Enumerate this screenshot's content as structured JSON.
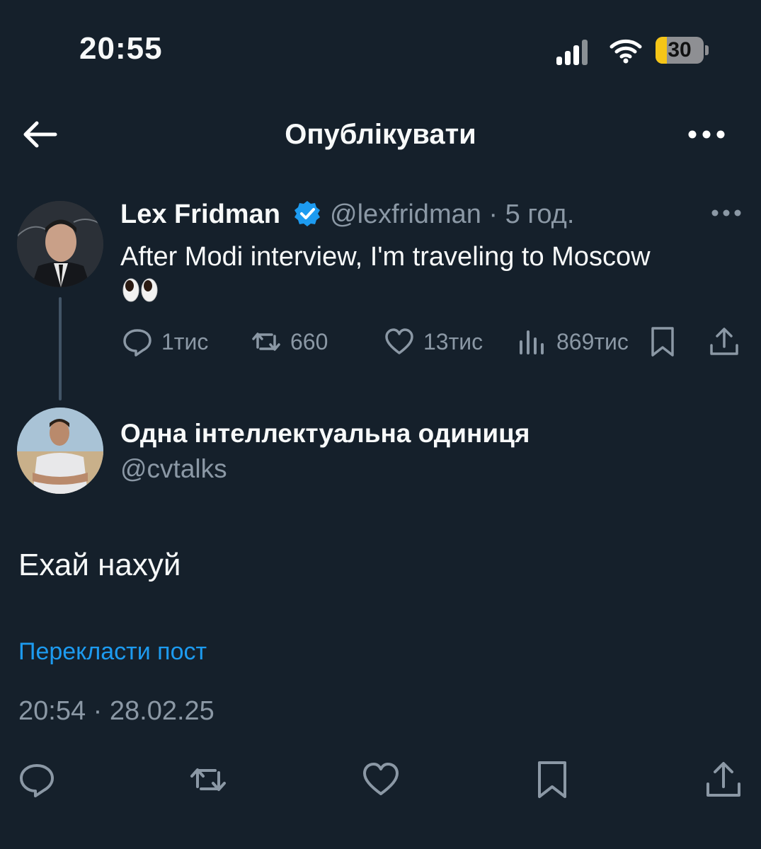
{
  "status_bar": {
    "time": "20:55",
    "battery": "30"
  },
  "header": {
    "title": "Опублікувати"
  },
  "tweet": {
    "author_name": "Lex Fridman",
    "author_handle_time": "@lexfridman · 5 год.",
    "text": "After Modi interview, I'm traveling to Moscow",
    "emoji": "eyes",
    "stats": {
      "replies": "1тис",
      "reposts": "660",
      "likes": "13тис",
      "views": "869тис"
    }
  },
  "reply": {
    "author_name": "Одна інтеллектуальна одиниця",
    "author_handle": "@cvtalks",
    "text": "Ехай нахуй",
    "translate_link": "Перекласти пост",
    "timestamp": "20:54 · 28.02.25"
  },
  "colors": {
    "background": "#15202b",
    "accent": "#1d9bf0",
    "muted": "#8b98a5"
  }
}
